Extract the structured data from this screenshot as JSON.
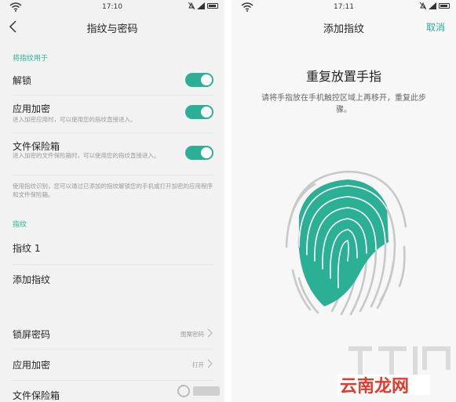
{
  "left": {
    "status": {
      "time": "17:10"
    },
    "title": "指纹与密码",
    "section_use": "将指纹用于",
    "items": [
      {
        "label": "解锁",
        "sub": "",
        "enabled": true
      },
      {
        "label": "应用加密",
        "sub": "进入加密应用时，可以使用您的指纹直接进入。",
        "enabled": true
      },
      {
        "label": "文件保险箱",
        "sub": "进入加密的文件保险箱时，可以使用您的指纹直接进入。",
        "enabled": true
      }
    ],
    "note": "使用指纹识别，您可以通过已添加的指纹解锁您的手机或打开加密的应用程序和文件保险箱。",
    "section_fingerprint": "指纹",
    "fingerprint_1": "指纹 1",
    "add_fingerprint": "添加指纹",
    "lock_password": {
      "label": "锁屏密码",
      "value": "图案密码"
    },
    "app_lock": {
      "label": "应用加密",
      "value": "打开"
    },
    "file_vault": {
      "label": "文件保险箱"
    }
  },
  "right": {
    "status": {
      "time": "17:11"
    },
    "title": "添加指纹",
    "cancel": "取消",
    "heading": "重复放置手指",
    "instruction": "请将手指放在手机触控区域上再移开，重复此步骤。"
  },
  "watermark": {
    "text": "云南龙网"
  },
  "colors": {
    "accent": "#2bb096",
    "fingerprint_gray": "#c8c8c8"
  }
}
